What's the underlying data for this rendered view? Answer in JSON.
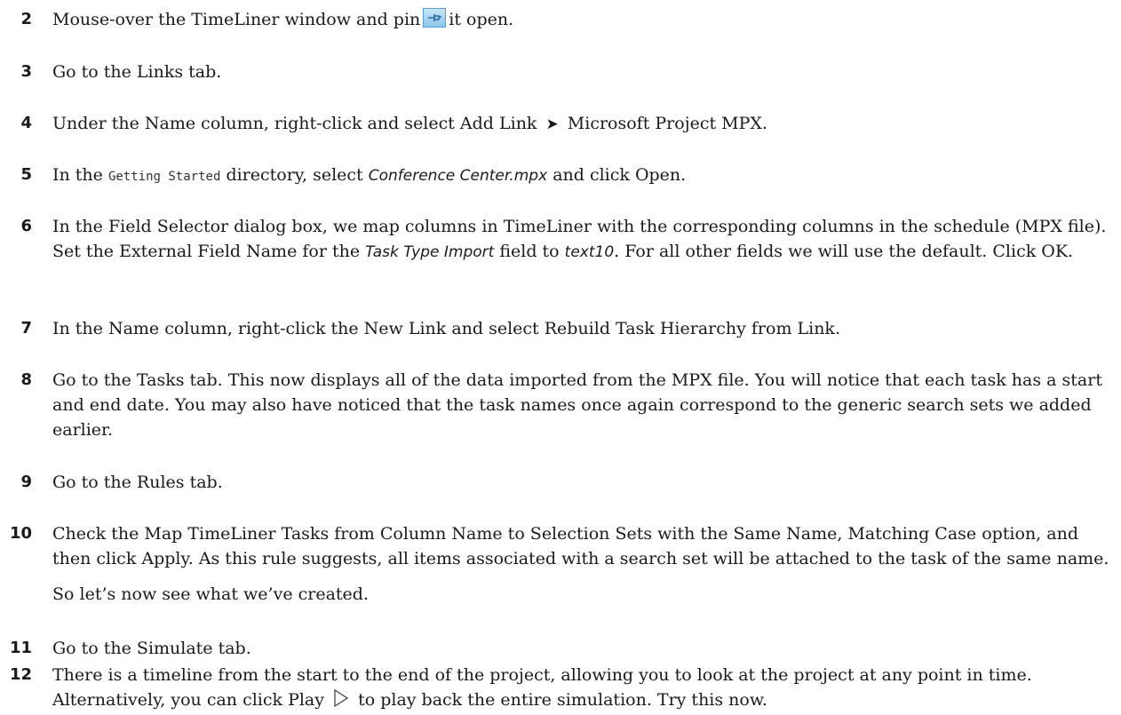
{
  "steps": [
    {
      "num": "2",
      "pre": "Mouse-over the TimeLiner window and pin",
      "post": "it open."
    },
    {
      "num": "3",
      "text": "Go to the Links tab."
    },
    {
      "num": "4",
      "pre": "Under the Name column, right-click and select Add Link",
      "arrow": "➤",
      "post": "Microsoft Project MPX."
    },
    {
      "num": "5",
      "pre": "In the",
      "code": "Getting Started",
      "mid": "directory, select",
      "italic": "Conference Center.mpx",
      "post": "and click Open."
    },
    {
      "num": "6",
      "a": "In the Field Selector dialog box, we map columns in TimeLiner with the corresponding columns in the schedule (MPX file). Set the External Field Name for the",
      "i1": "Task Type Import",
      "b": "field to",
      "i2": "text10",
      "c": ". For all other fields we will use the default. Click OK."
    },
    {
      "num": "7",
      "text": "In the Name column, right-click the New Link and select Rebuild Task Hierarchy from Link."
    },
    {
      "num": "8",
      "text": "Go to the Tasks tab. This now displays all of the data imported from the MPX file. You will notice that each task has a start and end date. You may also have noticed that the task names once again correspond to the generic search sets we added earlier."
    },
    {
      "num": "9",
      "text": "Go to the Rules tab."
    },
    {
      "num": "10",
      "text": "Check the Map TimeLiner Tasks from Column Name to Selection Sets with the Same Name, Matching Case option, and then click Apply. As this rule suggests, all items associated with a search set will be attached to the task of the same name.",
      "extra": "So let’s now see what we’ve created."
    },
    {
      "num": "11",
      "text": "Go to the Simulate tab."
    },
    {
      "num": "12",
      "pre": "There is a timeline from the start to the end of the project, allowing you to look at the project at any point in time. Alternatively, you can click Play",
      "post": "to play back the entire simulation. Try this now."
    }
  ],
  "icons": {
    "pin": "pin-icon",
    "play": "play-icon"
  }
}
